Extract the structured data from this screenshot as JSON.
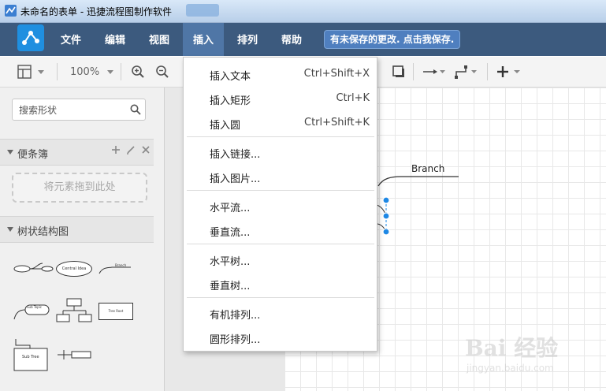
{
  "window": {
    "title": "未命名的表单 - 迅捷流程图制作软件"
  },
  "menu": {
    "items": [
      {
        "label": "文件"
      },
      {
        "label": "编辑"
      },
      {
        "label": "视图"
      },
      {
        "label": "插入",
        "active": true
      },
      {
        "label": "排列"
      },
      {
        "label": "帮助"
      }
    ],
    "unsaved_notice": "有未保存的更改. 点击我保存."
  },
  "toolbar": {
    "zoom": "100%",
    "icons": [
      "panel-layout-icon",
      "zoom-in-icon",
      "zoom-out-icon",
      "shadow-icon",
      "connector-arrow-icon",
      "waypoint-icon",
      "add-icon"
    ]
  },
  "sidebar": {
    "search_placeholder": "搜索形状",
    "scratchpad": {
      "title": "便条簿",
      "drop_hint": "将元素拖到此处"
    },
    "tree": {
      "title": "树状结构图",
      "shapes": {
        "central_idea": "Central Idea",
        "branch": "Branch",
        "sub_topic": "Sub Topic",
        "tree_root": "Tree Root",
        "sub_tree": "Sub Tree"
      }
    }
  },
  "insert_menu": {
    "groups": [
      [
        {
          "label": "插入文本",
          "shortcut": "Ctrl+Shift+X"
        },
        {
          "label": "插入矩形",
          "shortcut": "Ctrl+K"
        },
        {
          "label": "插入圆",
          "shortcut": "Ctrl+Shift+K"
        }
      ],
      [
        {
          "label": "插入链接..."
        },
        {
          "label": "插入图片..."
        }
      ],
      [
        {
          "label": "水平流..."
        },
        {
          "label": "垂直流..."
        }
      ],
      [
        {
          "label": "水平树..."
        },
        {
          "label": "垂直树..."
        }
      ],
      [
        {
          "label": "有机排列..."
        },
        {
          "label": "圆形排列..."
        }
      ]
    ]
  },
  "canvas": {
    "branch_label": "Branch"
  },
  "watermark": {
    "main": "Bai 经验",
    "sub": "jingyan.baidu.com"
  },
  "colors": {
    "appbar": "#3a5c86",
    "active_menu": "#4f76a6",
    "selection": "#1e88e5"
  }
}
